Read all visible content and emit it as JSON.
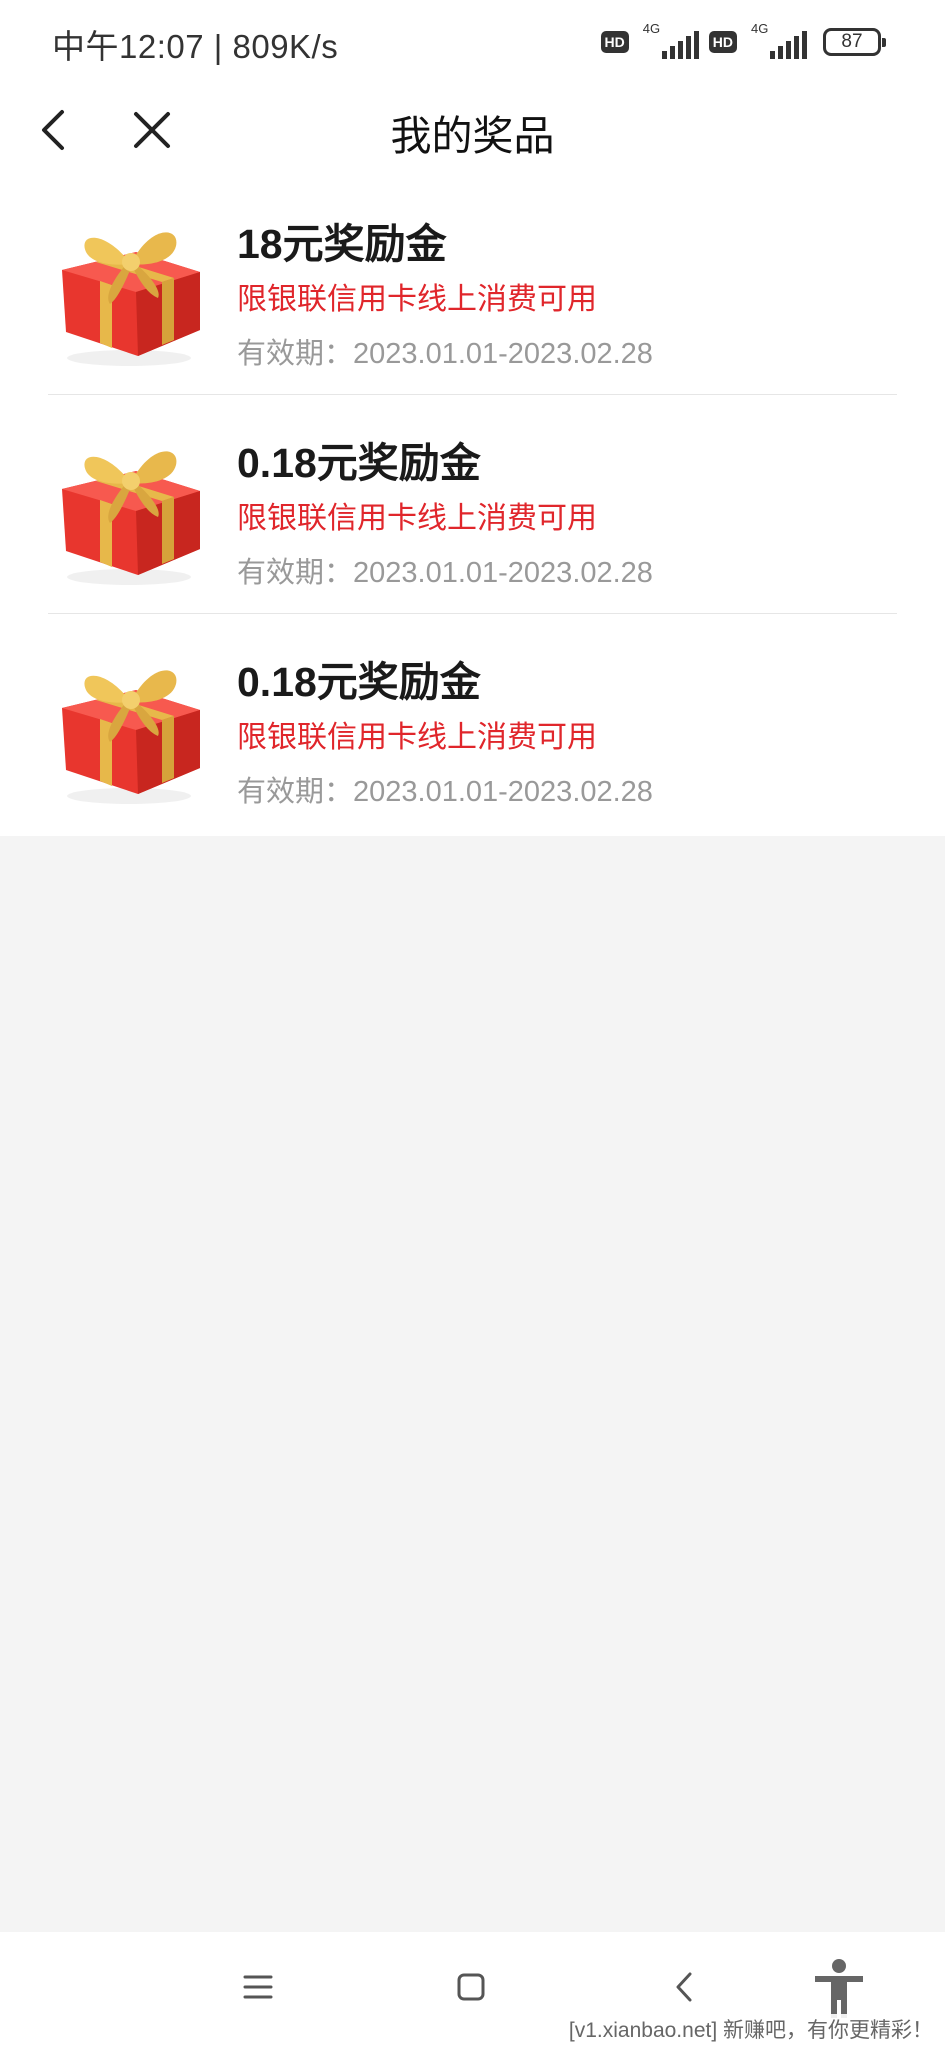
{
  "status_bar": {
    "time_speed": "中午12:07 | 809K/s",
    "hd1": "HD",
    "net1": "4G",
    "hd2": "HD",
    "net2": "4G",
    "battery": "87"
  },
  "header": {
    "title": "我的奖品",
    "back_icon": "chevron-left-icon",
    "close_icon": "close-icon"
  },
  "prizes": [
    {
      "title": "18元奖励金",
      "restriction": "限银联信用卡线上消费可用",
      "validity": "有效期：2023.01.01-2023.02.28",
      "icon": "gift-box-icon"
    },
    {
      "title": "0.18元奖励金",
      "restriction": "限银联信用卡线上消费可用",
      "validity": "有效期：2023.01.01-2023.02.28",
      "icon": "gift-box-icon"
    },
    {
      "title": "0.18元奖励金",
      "restriction": "限银联信用卡线上消费可用",
      "validity": "有效期：2023.01.01-2023.02.28",
      "icon": "gift-box-icon"
    }
  ],
  "nav_bar": {
    "menu_icon": "menu-icon",
    "home_icon": "home-square-icon",
    "back_icon": "back-chevron-icon",
    "accessibility_icon": "accessibility-icon"
  },
  "watermark": "[v1.xianbao.net] 新赚吧，有你更精彩！",
  "colors": {
    "accent_red": "#e0262b",
    "text_gray": "#999999",
    "background": "#f4f4f4"
  }
}
